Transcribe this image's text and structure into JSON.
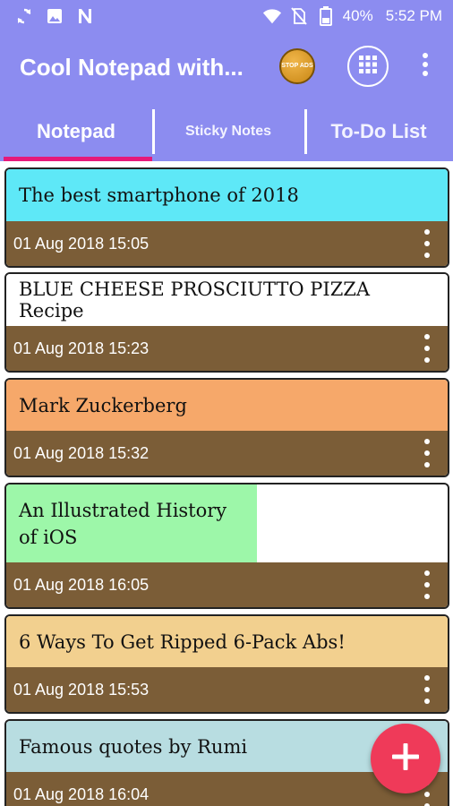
{
  "status_bar": {
    "battery_percent": "40%",
    "time": "5:52 PM",
    "icons": [
      "sync-icon",
      "image-icon",
      "n-icon",
      "wifi-icon",
      "no-sim-icon",
      "battery-icon"
    ]
  },
  "app_bar": {
    "title": "Cool Notepad with...",
    "stop_ads_label": "STOP ADS",
    "colors": {
      "bar": "#8c8cf0",
      "accent": "#e6197a"
    }
  },
  "tabs": [
    {
      "label": "Notepad",
      "active": true
    },
    {
      "label": "Sticky Notes",
      "active": false
    },
    {
      "label": "To-Do List",
      "active": false
    }
  ],
  "notes": [
    {
      "title": "The best smartphone of 2018",
      "date": "01 Aug 2018 15:05",
      "color": "#5ee8f7"
    },
    {
      "title": "BLUE CHEESE PROSCIUTTO PIZZA Recipe",
      "date": "01 Aug 2018 15:23",
      "color": "#ffffff"
    },
    {
      "title": "Mark Zuckerberg",
      "date": "01 Aug 2018 15:32",
      "color": "#f6a86a"
    },
    {
      "title": "An Illustrated History of iOS",
      "date": "01 Aug 2018 16:05",
      "color": "#9df7a9"
    },
    {
      "title": "6 Ways To Get Ripped 6-Pack Abs!",
      "date": "01 Aug 2018 15:53",
      "color": "#f2d08f"
    },
    {
      "title": "Famous quotes by Rumi",
      "date": "01 Aug 2018 16:04",
      "color": "#b8dde1"
    }
  ],
  "fab": {
    "icon": "plus-icon",
    "color": "#ef3a59"
  }
}
